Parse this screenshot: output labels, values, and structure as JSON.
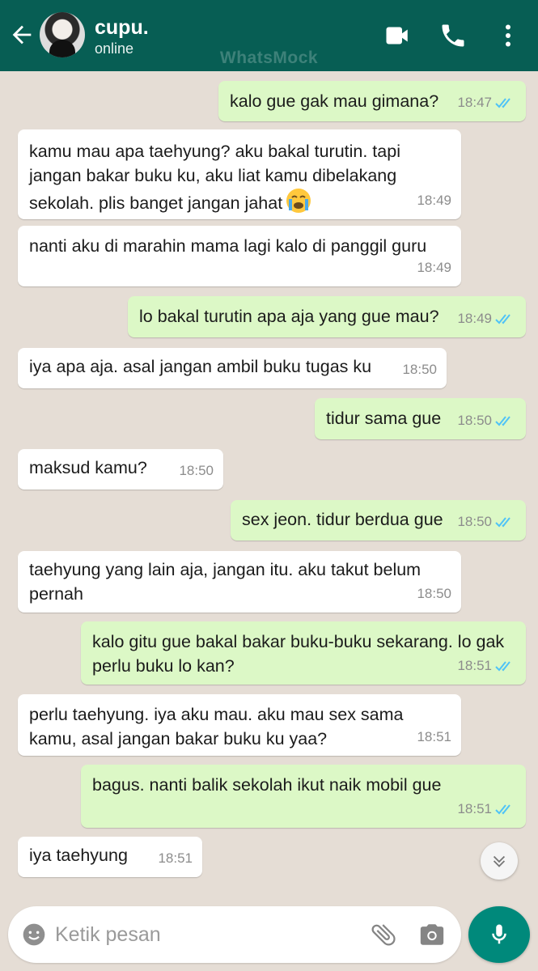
{
  "header": {
    "contact_name": "cupu.",
    "status": "online",
    "watermark": "WhatsMock"
  },
  "icons": {
    "back": "arrow-left-icon",
    "video": "video-camera-icon",
    "call": "phone-icon",
    "menu": "more-vert-icon",
    "emoji": "smiley-icon",
    "attach": "paperclip-icon",
    "camera": "camera-icon",
    "mic": "microphone-icon",
    "scroll": "chevron-double-down-icon"
  },
  "colors": {
    "header": "#075e54",
    "outgoing_bubble": "#dcf8c6",
    "incoming_bubble": "#ffffff",
    "read_ticks": "#4fc3f7",
    "mic_button": "#00897b"
  },
  "messages": [
    {
      "direction": "out",
      "text": "kalo gue gak mau gimana?",
      "time": "18:47",
      "read": true
    },
    {
      "direction": "in",
      "text": "kamu mau apa taehyung? aku bakal turutin. tapi jangan bakar buku ku, aku liat kamu dibelakang sekolah. plis banget jangan jahat",
      "emoji": "loudly-crying-face",
      "time": "18:49"
    },
    {
      "direction": "in",
      "text": "nanti aku di marahin mama lagi kalo di panggil guru",
      "time": "18:49"
    },
    {
      "direction": "out",
      "text": "lo bakal turutin apa aja yang gue mau?",
      "time": "18:49",
      "read": true
    },
    {
      "direction": "in",
      "text": "iya apa aja. asal jangan ambil buku tugas ku",
      "time": "18:50"
    },
    {
      "direction": "out",
      "text": "tidur sama gue",
      "time": "18:50",
      "read": true
    },
    {
      "direction": "in",
      "text": "maksud kamu?",
      "time": "18:50"
    },
    {
      "direction": "out",
      "text": "sex jeon. tidur berdua gue",
      "time": "18:50",
      "read": true
    },
    {
      "direction": "in",
      "text": "taehyung yang lain aja, jangan itu. aku takut belum pernah",
      "time": "18:50"
    },
    {
      "direction": "out",
      "text": "kalo gitu gue bakal bakar buku-buku sekarang. lo gak perlu buku lo kan?",
      "time": "18:51",
      "read": true
    },
    {
      "direction": "in",
      "text": "perlu taehyung. iya aku mau. aku mau sex sama kamu, asal jangan bakar buku ku yaa?",
      "time": "18:51"
    },
    {
      "direction": "out",
      "text": "bagus. nanti balik sekolah ikut naik mobil gue",
      "time": "18:51",
      "read": true
    },
    {
      "direction": "in",
      "text": "iya taehyung",
      "time": "18:51"
    }
  ],
  "composer": {
    "placeholder": "Ketik pesan"
  }
}
